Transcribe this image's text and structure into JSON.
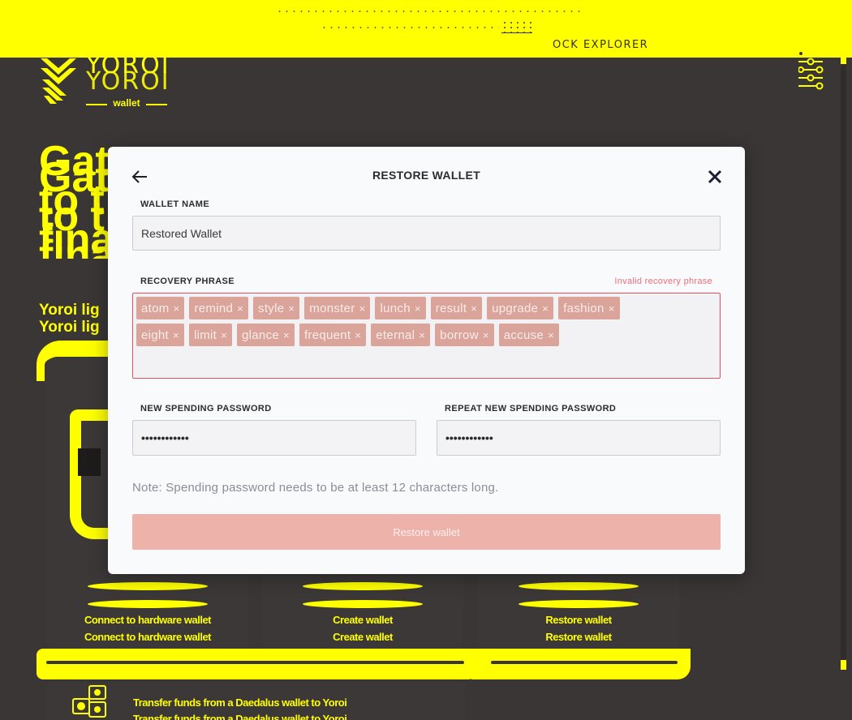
{
  "banner": {
    "partial_link_label": "OCK EXPLORER"
  },
  "logo": {
    "wordmark": "YOROI",
    "subtitle": "wallet"
  },
  "hero": {
    "title_lines": [
      "Gat",
      "to t",
      "fina"
    ],
    "subtitle": "Yoroi lig"
  },
  "cards": [
    {
      "label": "Connect to hardware wallet"
    },
    {
      "label": "Create wallet"
    },
    {
      "label": "Restore wallet"
    }
  ],
  "transfer": {
    "label": "Transfer funds from a Daedalus wallet to Yoroi"
  },
  "modal": {
    "title": "RESTORE WALLET",
    "wallet_name": {
      "label": "WALLET NAME",
      "value": "Restored Wallet"
    },
    "recovery_phrase": {
      "label": "RECOVERY PHRASE",
      "error": "Invalid recovery phrase",
      "words": [
        "atom",
        "remind",
        "style",
        "monster",
        "lunch",
        "result",
        "upgrade",
        "fashion",
        "eight",
        "limit",
        "glance",
        "frequent",
        "eternal",
        "borrow",
        "accuse"
      ],
      "remove_glyph": "×"
    },
    "new_password": {
      "label": "NEW SPENDING PASSWORD",
      "value": "••••••••••••"
    },
    "repeat_password": {
      "label": "REPEAT NEW SPENDING PASSWORD",
      "value": "••••••••••••"
    },
    "note": "Note: Spending password needs to be at least 12 characters long.",
    "submit_label": "Restore wallet"
  },
  "colors": {
    "accent_yellow": "#ffff00",
    "background": "#3a3636",
    "error": "#e1525f",
    "chip": "#daa49b",
    "disabled_button": "#edb2aa"
  }
}
